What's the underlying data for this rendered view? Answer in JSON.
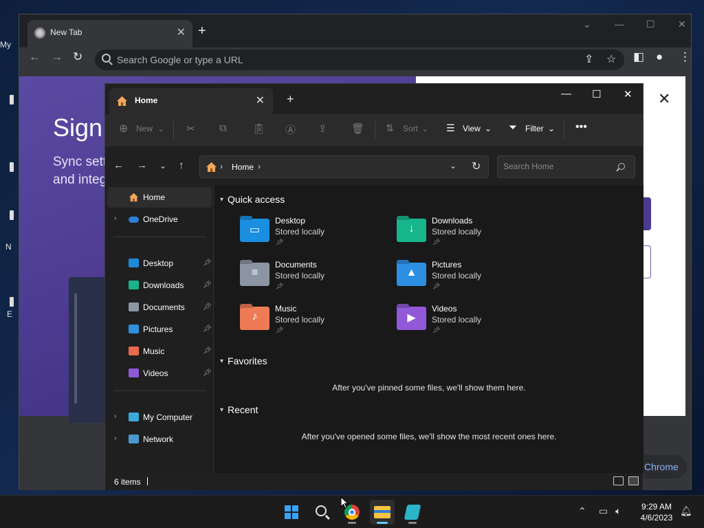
{
  "desktop": {
    "icon_labels": [
      "My",
      "N",
      "E"
    ]
  },
  "chrome": {
    "tab_title": "New Tab",
    "omnibox_placeholder": "Search Google or type a URL",
    "page": {
      "heading": "Sign",
      "sync_line1": "Sync sett",
      "sync_line2": "and integ",
      "chip_label": "Chrome"
    }
  },
  "explorer": {
    "tab_title": "Home",
    "commands": {
      "new": "New",
      "sort": "Sort",
      "view": "View",
      "filter": "Filter"
    },
    "address": {
      "crumb": "Home",
      "search_placeholder": "Search Home"
    },
    "nav": {
      "home": "Home",
      "onedrive": "OneDrive",
      "pinned": [
        {
          "label": "Desktop",
          "icon": "desktop-icon",
          "color": "#1e88d8"
        },
        {
          "label": "Downloads",
          "icon": "downloads-icon",
          "color": "#19b38a"
        },
        {
          "label": "Documents",
          "icon": "documents-icon",
          "color": "#8d96a3"
        },
        {
          "label": "Pictures",
          "icon": "pictures-icon",
          "color": "#2f8fdb"
        },
        {
          "label": "Music",
          "icon": "music-icon",
          "color": "#e86a4f"
        },
        {
          "label": "Videos",
          "icon": "videos-icon",
          "color": "#8e5ad6"
        }
      ],
      "my_computer": "My Computer",
      "network": "Network"
    },
    "quick_access": {
      "title": "Quick access",
      "items": [
        {
          "name": "Desktop",
          "status": "Stored locally",
          "icon": "desktop-folder-icon",
          "color": "#1a8ee0"
        },
        {
          "name": "Downloads",
          "status": "Stored locally",
          "icon": "downloads-folder-icon",
          "color": "#17b58c"
        },
        {
          "name": "Documents",
          "status": "Stored locally",
          "icon": "documents-folder-icon",
          "color": "#8b95a3"
        },
        {
          "name": "Pictures",
          "status": "Stored locally",
          "icon": "pictures-folder-icon",
          "color": "#2d8fe3"
        },
        {
          "name": "Music",
          "status": "Stored locally",
          "icon": "music-folder-icon",
          "color": "#ef7a56"
        },
        {
          "name": "Videos",
          "status": "Stored locally",
          "icon": "videos-folder-icon",
          "color": "#9158d9"
        }
      ]
    },
    "favorites": {
      "title": "Favorites",
      "empty": "After you've pinned some files, we'll show them here."
    },
    "recent": {
      "title": "Recent",
      "empty": "After you've opened some files, we'll show the most recent ones here."
    },
    "status_count": "6 items"
  },
  "taskbar": {
    "time": "9:29 AM",
    "date": "4/6/2023"
  }
}
